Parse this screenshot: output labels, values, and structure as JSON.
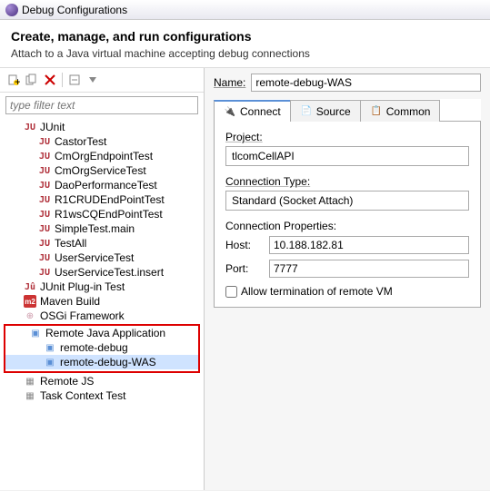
{
  "titlebar": {
    "title": "Debug Configurations"
  },
  "header": {
    "title": "Create, manage, and run configurations",
    "subtitle": "Attach to a Java virtual machine accepting debug connections"
  },
  "filter": {
    "placeholder": "type filter text"
  },
  "tree": {
    "junit": {
      "label": "JUnit"
    },
    "junit_children": [
      "CastorTest",
      "CmOrgEndpointTest",
      "CmOrgServiceTest",
      "DaoPerformanceTest",
      "R1CRUDEndPointTest",
      "R1wsCQEndPointTest",
      "SimpleTest.main",
      "TestAll",
      "UserServiceTest",
      "UserServiceTest.insert"
    ],
    "junit_plugin": "JUnit Plug-in Test",
    "maven": "Maven Build",
    "osgi": "OSGi Framework",
    "remote_java": "Remote Java Application",
    "remote_java_children": [
      "remote-debug",
      "remote-debug-WAS"
    ],
    "remote_js": "Remote JS",
    "task_context": "Task Context Test"
  },
  "form": {
    "name_label": "Name:",
    "name_value": "remote-debug-WAS",
    "tabs": {
      "connect": "Connect",
      "source": "Source",
      "common": "Common"
    },
    "project_label": "Project:",
    "project_value": "tlcomCellAPI",
    "conn_type_label": "Connection Type:",
    "conn_type_value": "Standard (Socket Attach)",
    "conn_props_label": "Connection Properties:",
    "host_label": "Host:",
    "host_value": "10.188.182.81",
    "port_label": "Port:",
    "port_value": "7777",
    "allow_term": "Allow termination of remote VM"
  }
}
